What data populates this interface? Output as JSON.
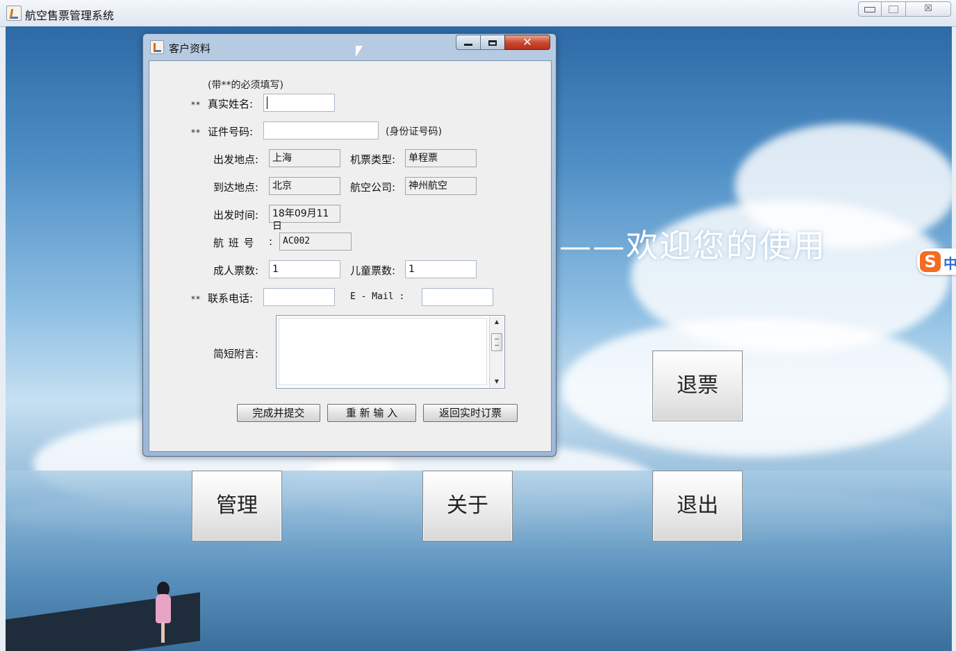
{
  "main_window": {
    "title": "航空售票管理系统",
    "controls": {
      "minimize": "",
      "maximize": "",
      "close": "☒"
    }
  },
  "desktop": {
    "welcome_text": "——欢迎您的使用",
    "buttons": {
      "refund": "退票",
      "manage": "管理",
      "about": "关于",
      "exit": "退出"
    },
    "ime": {
      "logo": "S",
      "mode": "中"
    }
  },
  "dialog": {
    "title": "客户资料",
    "close_glyph": "✕",
    "hint": "(带**的必须填写)",
    "required_mark": "**",
    "labels": {
      "real_name": "真实姓名:",
      "id_number": "证件号码:",
      "id_hint": "(身份证号码)",
      "departure": "出发地点:",
      "ticket_type": "机票类型:",
      "arrival": "到达地点:",
      "airline": "航空公司:",
      "depart_time": "出发时间:",
      "flight_no": "航 班 号",
      "flight_colon": ":",
      "adult_count": "成人票数:",
      "child_count": "儿童票数:",
      "phone": "联系电话:",
      "email": "E - Mail :",
      "note": "简短附言:"
    },
    "values": {
      "real_name": "",
      "id_number": "",
      "departure": "上海",
      "ticket_type": "单程票",
      "arrival": "北京",
      "airline": "神州航空",
      "depart_time": "18年09月11日",
      "flight_no": "AC002",
      "adult_count": "1",
      "child_count": "1",
      "phone": "",
      "email": "",
      "note": ""
    },
    "buttons": {
      "submit": "完成并提交",
      "reset": "重 新 输 入",
      "back": "返回实时订票"
    }
  }
}
